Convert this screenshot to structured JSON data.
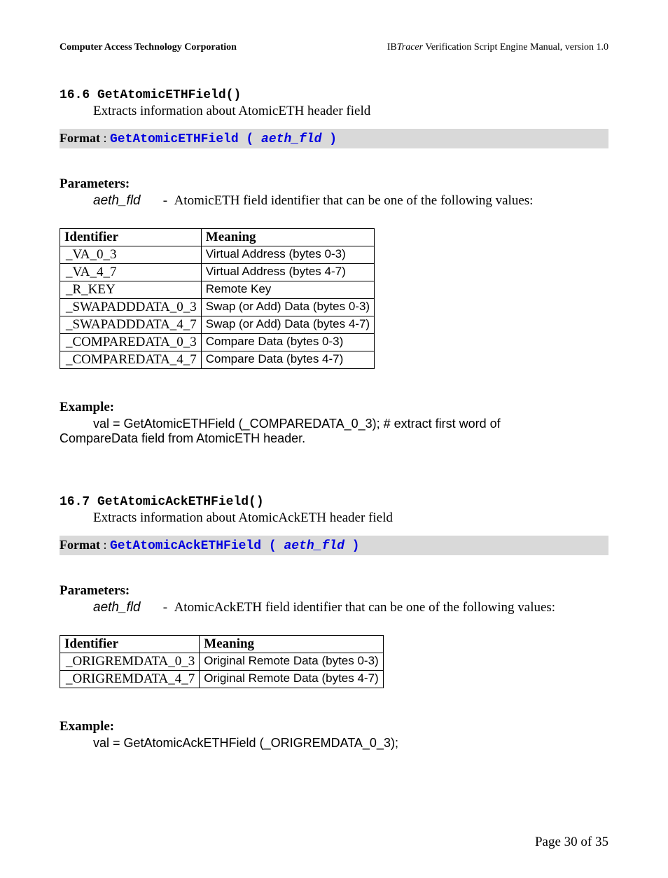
{
  "header": {
    "left": "Computer Access Technology Corporation",
    "right_ib": "IB",
    "right_tracer": "Tracer",
    "right_rest": " Verification Script Engine Manual, version 1.0"
  },
  "section1": {
    "num_title": "16.6 GetAtomicETHField()",
    "desc": "Extracts information about AtomicETH header field",
    "format_label": "Format",
    "format_colon": " :   ",
    "format_func": "GetAtomicETHField ( ",
    "format_param": "aeth_fld",
    "format_close": " )",
    "params_label": "Parameters:",
    "param_name": "aeth_fld",
    "param_dash": "-",
    "param_desc": "AtomicETH field identifier that can be one of the following values:",
    "table_headers": [
      "Identifier",
      "Meaning"
    ],
    "table_rows": [
      {
        "id": "_VA_0_3",
        "meaning": "Virtual Address (bytes 0-3)"
      },
      {
        "id": "_VA_4_7",
        "meaning": "Virtual Address (bytes 4-7)"
      },
      {
        "id": "_R_KEY",
        "meaning": "Remote Key"
      },
      {
        "id": "_SWAPADDDATA_0_3",
        "meaning": "Swap (or Add) Data (bytes 0-3)"
      },
      {
        "id": "_SWAPADDDATA_4_7",
        "meaning": "Swap (or Add) Data (bytes 4-7)"
      },
      {
        "id": "_COMPAREDATA_0_3",
        "meaning": "Compare Data (bytes 0-3)"
      },
      {
        "id": "_COMPAREDATA_4_7",
        "meaning": "Compare Data (bytes 4-7)"
      }
    ],
    "example_label": "Example:",
    "example_line1": "val  = GetAtomicETHField (_COMPAREDATA_0_3); # extract first word of",
    "example_line2": "CompareData field from AtomicETH header."
  },
  "section2": {
    "num_title": "16.7 GetAtomicAckETHField()",
    "desc": "Extracts information about AtomicAckETH header field",
    "format_label": "Format",
    "format_colon": " :   ",
    "format_func": "GetAtomicAckETHField ( ",
    "format_param": "aeth_fld",
    "format_close": " )",
    "params_label": "Parameters:",
    "param_name": "aeth_fld",
    "param_dash": "-",
    "param_desc": "AtomicAckETH field identifier that can be one of the following values:",
    "table_headers": [
      "Identifier",
      "Meaning"
    ],
    "table_rows": [
      {
        "id": "_ORIGREMDATA_0_3",
        "meaning": "Original Remote Data (bytes 0-3)"
      },
      {
        "id": "_ORIGREMDATA_4_7",
        "meaning": "Original Remote Data (bytes 4-7)"
      }
    ],
    "example_label": "Example:",
    "example_line1": "val  = GetAtomicAckETHField (_ORIGREMDATA_0_3);"
  },
  "footer": "Page 30 of 35"
}
